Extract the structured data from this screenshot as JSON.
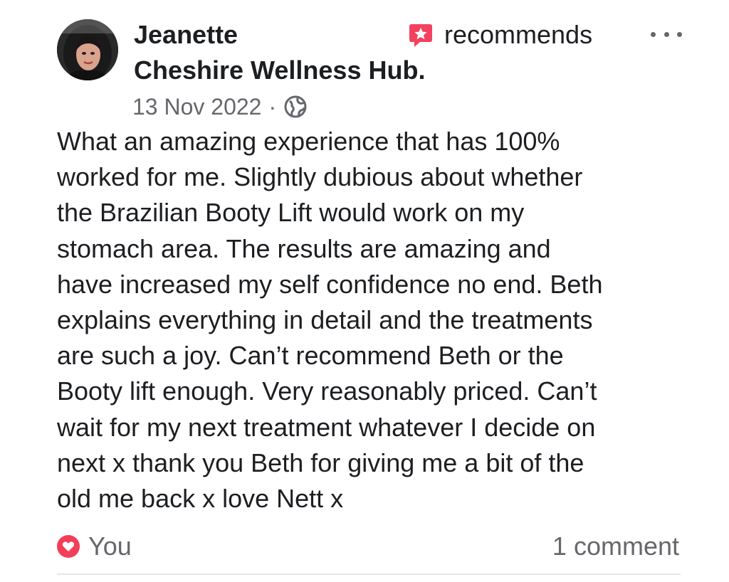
{
  "post": {
    "author_name": "Jeanette",
    "action_text": "recommends",
    "page_name": "Cheshire Wellness Hub.",
    "date": "13 Nov 2022",
    "separator": "·",
    "audience_icon": "globe-icon",
    "recommend_icon": "star-flag-icon",
    "more_icon": "more-dots-icon",
    "body_lines": [
      "What an amazing experience that has 100%",
      "worked for me. Slightly dubious about whether",
      "the Brazilian Booty Lift would work on my",
      "stomach area. The results are amazing and",
      "have increased my self confidence no end. Beth",
      "explains everything in detail and the treatments",
      "are such a joy. Can’t recommend Beth or the",
      "Booty lift enough. Very reasonably priced. Can’t",
      "wait for my next treatment whatever I decide on",
      "next x thank you Beth for giving me a bit of the",
      "old me back x love Nett x"
    ]
  },
  "reactions": {
    "icon": "heart-icon",
    "label": "You"
  },
  "comments": {
    "label": "1 comment"
  },
  "colors": {
    "text_primary": "#1c1e21",
    "text_secondary": "#65676b",
    "recommend_accent": "#f3425f",
    "heart_reaction": "#f33e58",
    "divider": "#e4e6eb"
  }
}
